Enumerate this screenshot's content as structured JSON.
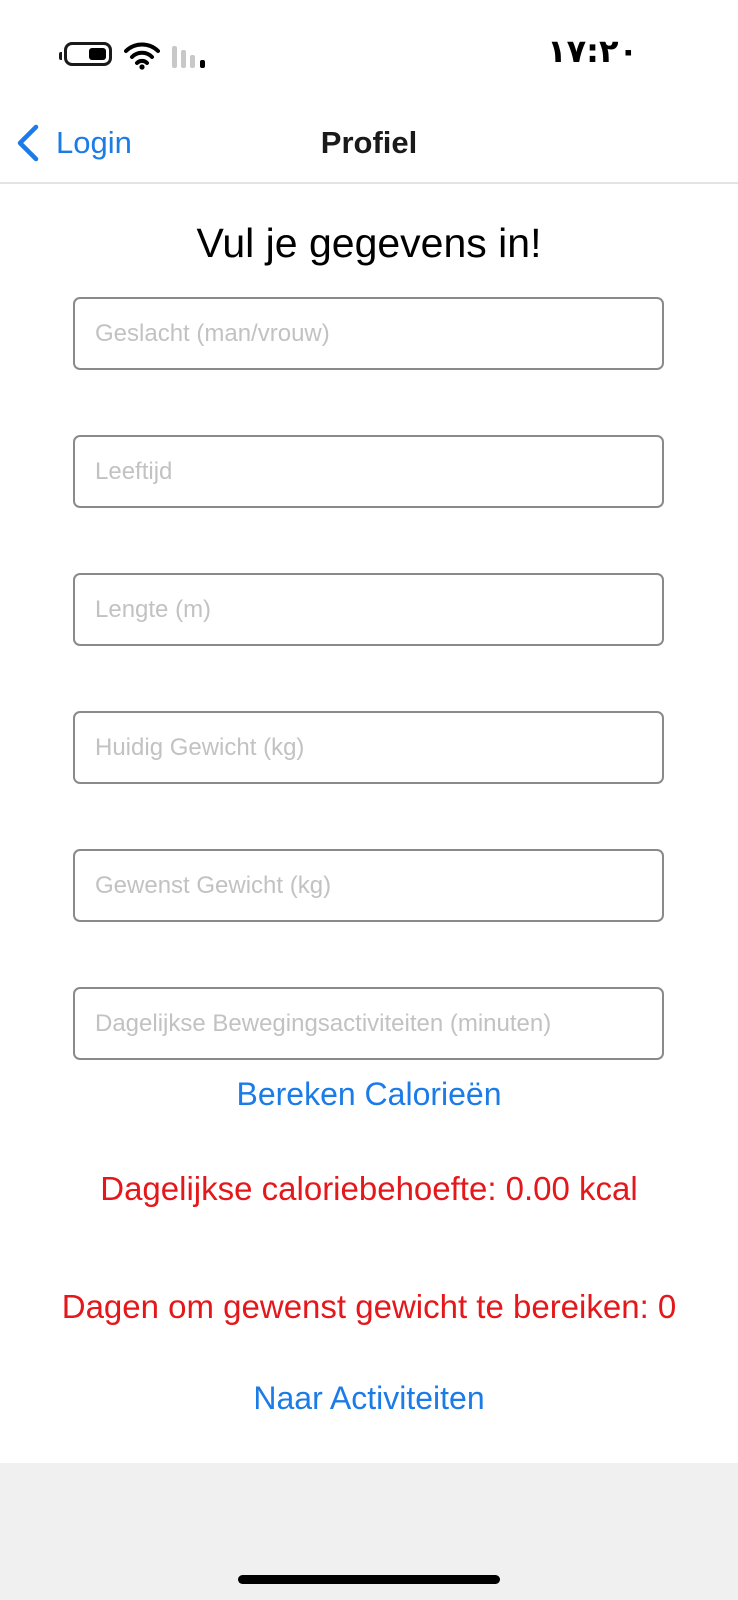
{
  "status_bar": {
    "time": "١٧:٢٠",
    "battery_icon": "battery-icon",
    "wifi_icon": "wifi-icon",
    "signal_icon": "cellular-signal-icon"
  },
  "nav": {
    "back_label": "Login",
    "back_icon": "chevron-left-icon",
    "title": "Profiel"
  },
  "form": {
    "heading": "Vul je gegevens in!",
    "fields": [
      {
        "placeholder": "Geslacht (man/vrouw)",
        "value": ""
      },
      {
        "placeholder": "Leeftijd",
        "value": ""
      },
      {
        "placeholder": "Lengte (m)",
        "value": ""
      },
      {
        "placeholder": "Huidig Gewicht (kg)",
        "value": ""
      },
      {
        "placeholder": "Gewenst Gewicht (kg)",
        "value": ""
      },
      {
        "placeholder": "Dagelijkse Bewegingsactiviteiten (minuten)",
        "value": ""
      }
    ],
    "calculate_label": "Bereken Calorieën"
  },
  "results": {
    "daily_calories": "Dagelijkse caloriebehoefte: 0.00 kcal",
    "days_to_goal": "Dagen om gewenst gewicht te bereiken: 0"
  },
  "footer": {
    "activities_label": "Naar Activiteiten"
  },
  "colors": {
    "accent": "#1b7be7",
    "result_text": "#e4181b",
    "placeholder": "#c2c2c2",
    "field_border": "#8a8a8a",
    "bottom_background": "#f0f0f0"
  }
}
